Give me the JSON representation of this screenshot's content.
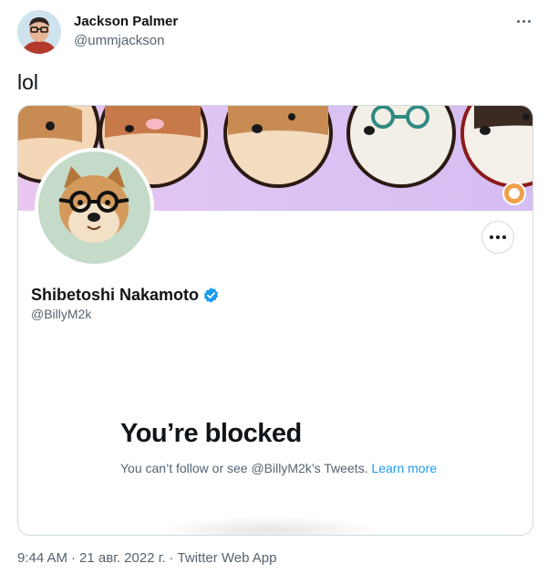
{
  "tweet": {
    "author_name": "Jackson Palmer",
    "author_handle": "@ummjackson",
    "text": "lol",
    "more_icon": "ellipsis-icon"
  },
  "card": {
    "profile_name": "Shibetoshi Nakamoto",
    "profile_handle": "@BillyM2k",
    "verified_icon": "verified-badge-icon",
    "blocked_title": "You’re blocked",
    "blocked_message": "You can’t follow or see @BillyM2k’s Tweets. ",
    "learn_more": "Learn more",
    "colors": {
      "link": "#1d9bf0",
      "verified": "#1d9bf0",
      "banner": "#d9c2f3"
    }
  },
  "footer": {
    "time": "9:44 AM",
    "separator": "·",
    "date": "21 авг. 2022 г.",
    "app": "Twitter Web App"
  }
}
